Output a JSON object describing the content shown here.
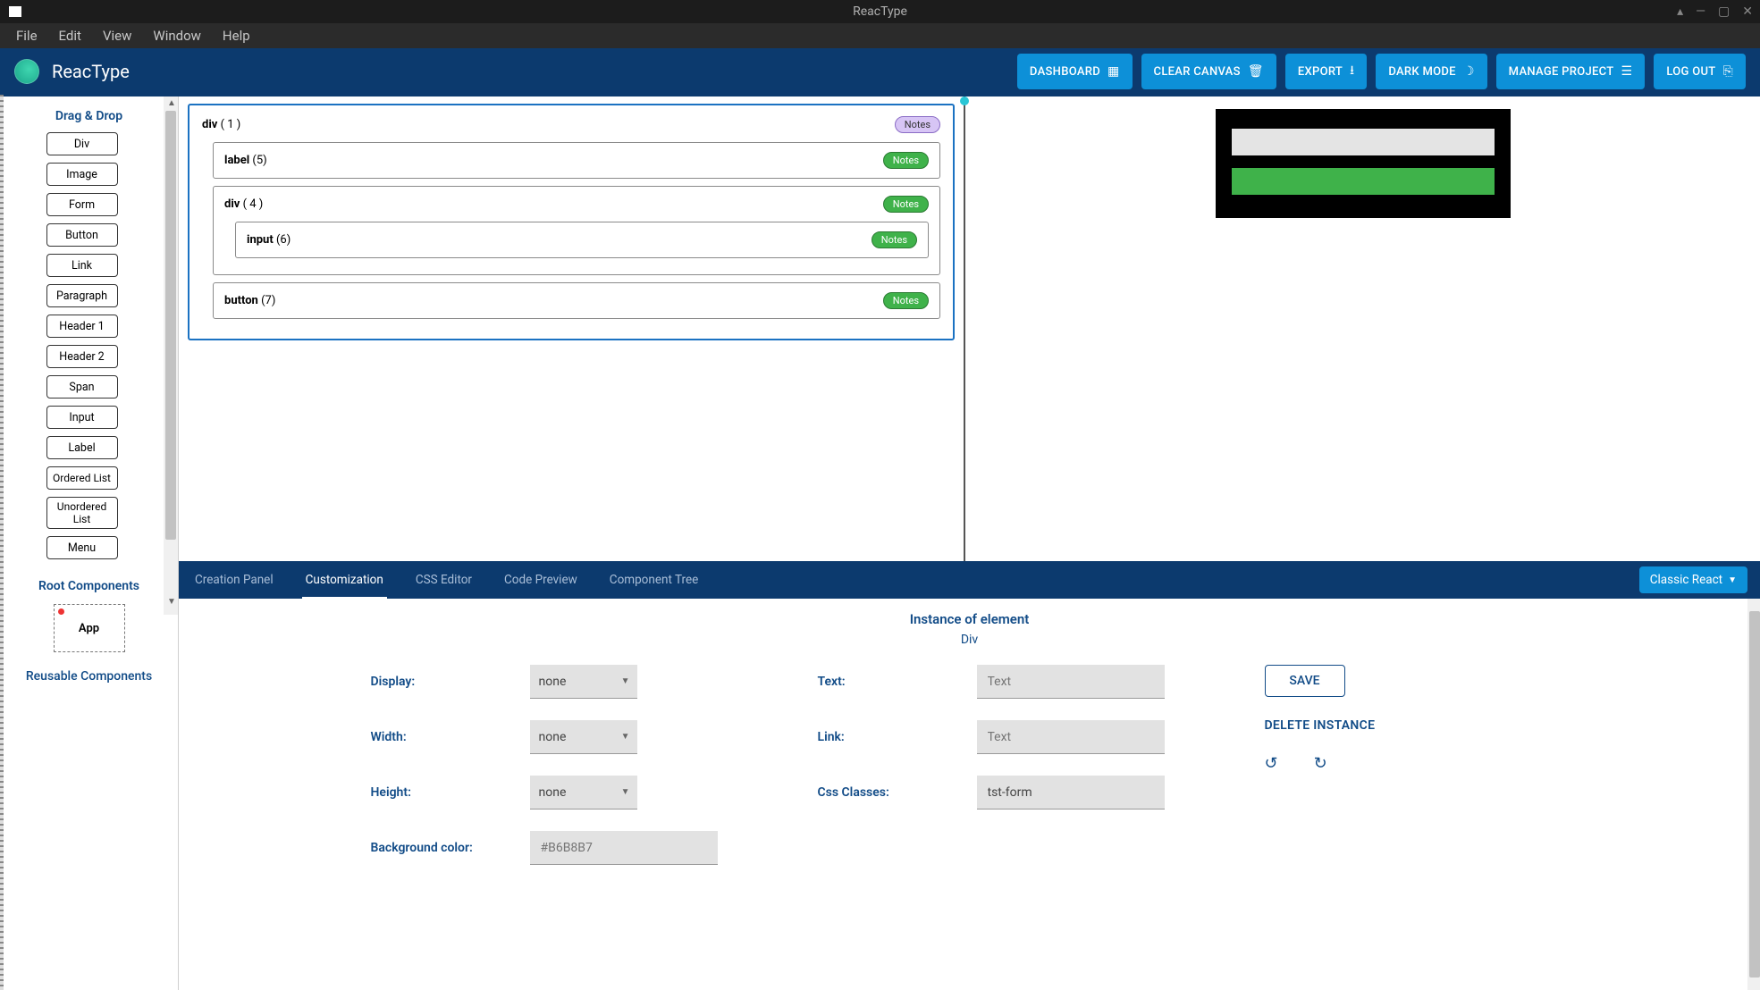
{
  "titlebar": {
    "title": "ReacType"
  },
  "menubar": {
    "items": [
      "File",
      "Edit",
      "View",
      "Window",
      "Help"
    ]
  },
  "appbar": {
    "name": "ReacType",
    "buttons": {
      "dashboard": "DASHBOARD",
      "clear": "CLEAR CANVAS",
      "export": "EXPORT",
      "darkmode": "DARK MODE",
      "manage": "MANAGE PROJECT",
      "logout": "LOG OUT"
    }
  },
  "left": {
    "drag_title": "Drag & Drop",
    "items": [
      "Div",
      "Image",
      "Form",
      "Button",
      "Link",
      "Paragraph",
      "Header 1",
      "Header 2",
      "Span",
      "Input",
      "Label",
      "Ordered List",
      "Unordered List",
      "Menu"
    ],
    "root_title": "Root Components",
    "root_item": "App",
    "reusable_title": "Reusable Components"
  },
  "canvas": {
    "root": {
      "tag": "div",
      "id": "( 1 )",
      "notes": "Notes"
    },
    "label": {
      "tag": "label",
      "id": "(5)",
      "notes": "Notes"
    },
    "div4": {
      "tag": "div",
      "id": "( 4 )",
      "notes": "Notes"
    },
    "input": {
      "tag": "input",
      "id": "(6)",
      "notes": "Notes"
    },
    "button": {
      "tag": "button",
      "id": "(7)",
      "notes": "Notes"
    }
  },
  "tabs": {
    "items": [
      "Creation Panel",
      "Customization",
      "CSS Editor",
      "Code Preview",
      "Component Tree"
    ],
    "active_index": 1,
    "mode": "Classic React"
  },
  "props": {
    "instance_title": "Instance of element",
    "element_name": "Div",
    "labels": {
      "display": "Display:",
      "width": "Width:",
      "height": "Height:",
      "bgcolor": "Background color:",
      "text": "Text:",
      "link": "Link:",
      "css": "Css Classes:"
    },
    "values": {
      "display": "none",
      "width": "none",
      "height": "none",
      "bgcolor_placeholder": "#B6B8B7",
      "text_placeholder": "Text",
      "link_placeholder": "Text",
      "css": "tst-form"
    },
    "save": "SAVE",
    "delete": "DELETE INSTANCE"
  }
}
